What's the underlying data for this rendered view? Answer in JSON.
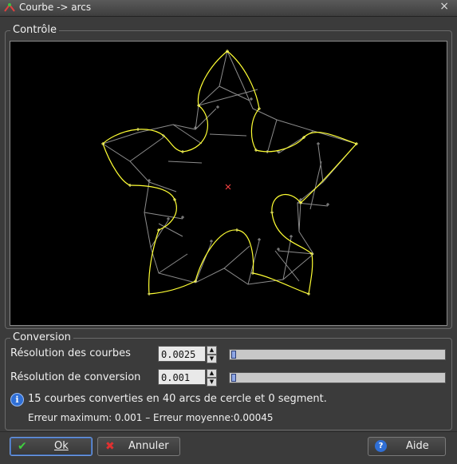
{
  "window": {
    "title": "Courbe -> arcs",
    "close_glyph": "×"
  },
  "controle": {
    "label": "Contrôle"
  },
  "conversion": {
    "label": "Conversion",
    "resolution_courbes": {
      "label": "Résolution des courbes",
      "value": "0.0025",
      "slider_fraction": 0.0
    },
    "resolution_conversion": {
      "label": "Résolution de conversion",
      "value": "0.001",
      "slider_fraction": 0.0
    },
    "info": "15 courbes converties en 40 arcs de cercle et 0 segment.",
    "erreur": "Erreur maximum: 0.001 – Erreur moyenne:0.00045"
  },
  "buttons": {
    "ok": "Ok",
    "annuler": "Annuler",
    "aide": "Aide"
  },
  "icons": {
    "ok": "check-icon",
    "annuler": "cross-icon",
    "aide": "help-icon",
    "info": "info-icon"
  },
  "colors": {
    "curve": "#ffff33",
    "construction": "#9a9a9a",
    "center": "#ff4444"
  }
}
